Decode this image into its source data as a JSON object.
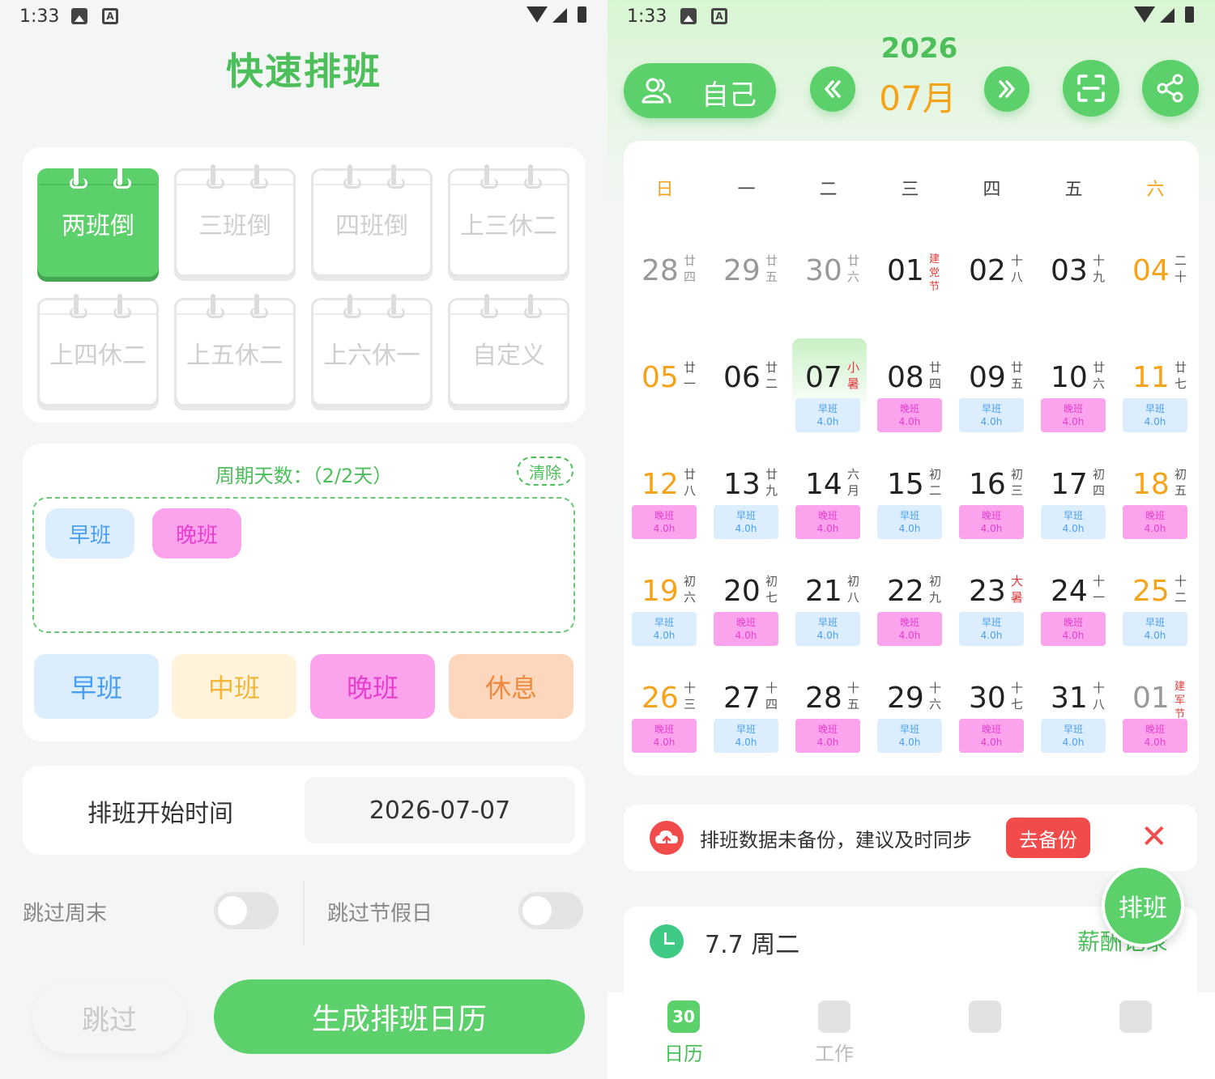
{
  "left": {
    "status": {
      "time": "1:33"
    },
    "title": "快速排班",
    "templates": [
      {
        "label": "两班倒",
        "active": true
      },
      {
        "label": "三班倒",
        "active": false
      },
      {
        "label": "四班倒",
        "active": false
      },
      {
        "label": "上三休二",
        "active": false
      },
      {
        "label": "上四休二",
        "active": false
      },
      {
        "label": "上五休二",
        "active": false
      },
      {
        "label": "上六休一",
        "active": false
      },
      {
        "label": "自定义",
        "active": false
      }
    ],
    "cycle": {
      "title": "周期天数：（2/2天）",
      "clear": "清除",
      "chips": [
        "早班",
        "晚班"
      ]
    },
    "shift_buttons": [
      "早班",
      "中班",
      "晚班",
      "休息"
    ],
    "start": {
      "label": "排班开始时间",
      "value": "2026-07-07"
    },
    "options": {
      "skip_weekend": "跳过周末",
      "skip_holiday": "跳过节假日"
    },
    "skip": "跳过",
    "generate": "生成排班日历"
  },
  "right": {
    "status": {
      "time": "1:33"
    },
    "year": "2026",
    "month": "07月",
    "self_button": "自己",
    "weekdays": [
      "日",
      "一",
      "二",
      "三",
      "四",
      "五",
      "六"
    ],
    "weeks": [
      [
        {
          "d": "28",
          "l": "廿四",
          "other": true
        },
        {
          "d": "29",
          "l": "廿五",
          "other": true
        },
        {
          "d": "30",
          "l": "廿六",
          "other": true
        },
        {
          "d": "01",
          "l": "建党节",
          "hol": true
        },
        {
          "d": "02",
          "l": "十八"
        },
        {
          "d": "03",
          "l": "十九"
        },
        {
          "d": "04",
          "l": "二十"
        }
      ],
      [
        {
          "d": "05",
          "l": "廿一"
        },
        {
          "d": "06",
          "l": "廿二"
        },
        {
          "d": "07",
          "l": "小暑",
          "hol": true,
          "today": true,
          "s": "e"
        },
        {
          "d": "08",
          "l": "廿四",
          "s": "n"
        },
        {
          "d": "09",
          "l": "廿五",
          "s": "e"
        },
        {
          "d": "10",
          "l": "廿六",
          "s": "n"
        },
        {
          "d": "11",
          "l": "廿七",
          "s": "e"
        }
      ],
      [
        {
          "d": "12",
          "l": "廿八",
          "s": "n"
        },
        {
          "d": "13",
          "l": "廿九",
          "s": "e"
        },
        {
          "d": "14",
          "l": "六月",
          "s": "n"
        },
        {
          "d": "15",
          "l": "初二",
          "s": "e"
        },
        {
          "d": "16",
          "l": "初三",
          "s": "n"
        },
        {
          "d": "17",
          "l": "初四",
          "s": "e"
        },
        {
          "d": "18",
          "l": "初五",
          "s": "n"
        }
      ],
      [
        {
          "d": "19",
          "l": "初六",
          "s": "e"
        },
        {
          "d": "20",
          "l": "初七",
          "s": "n"
        },
        {
          "d": "21",
          "l": "初八",
          "s": "e"
        },
        {
          "d": "22",
          "l": "初九",
          "s": "n"
        },
        {
          "d": "23",
          "l": "大暑",
          "hol": true,
          "s": "e"
        },
        {
          "d": "24",
          "l": "十一",
          "s": "n"
        },
        {
          "d": "25",
          "l": "十二",
          "s": "e"
        }
      ],
      [
        {
          "d": "26",
          "l": "十三",
          "s": "n"
        },
        {
          "d": "27",
          "l": "十四",
          "s": "e"
        },
        {
          "d": "28",
          "l": "十五",
          "s": "n"
        },
        {
          "d": "29",
          "l": "十六",
          "s": "e"
        },
        {
          "d": "30",
          "l": "十七",
          "s": "n"
        },
        {
          "d": "31",
          "l": "十八",
          "s": "e"
        },
        {
          "d": "01",
          "l": "建军节",
          "hol": true,
          "other": true,
          "s": "n"
        }
      ]
    ],
    "shift_labels": {
      "e": "早班",
      "n": "晚班"
    },
    "hours": "4.0h",
    "backup": {
      "text": "排班数据未备份，建议及时同步",
      "button": "去备份"
    },
    "day_info": {
      "date": "7.7 周二",
      "salary": "薪酬记录"
    },
    "fab": "排班",
    "tabs": [
      {
        "label": "日历",
        "icon": "30",
        "active": true
      },
      {
        "label": "工作",
        "active": false
      },
      {
        "label": "",
        "active": false
      },
      {
        "label": "",
        "active": false
      }
    ],
    "colors": {
      "accent": "#5cd06a",
      "orange": "#f5a31b",
      "red": "#f24b4b",
      "early": "#dceefd",
      "night": "#fca3ee"
    }
  }
}
